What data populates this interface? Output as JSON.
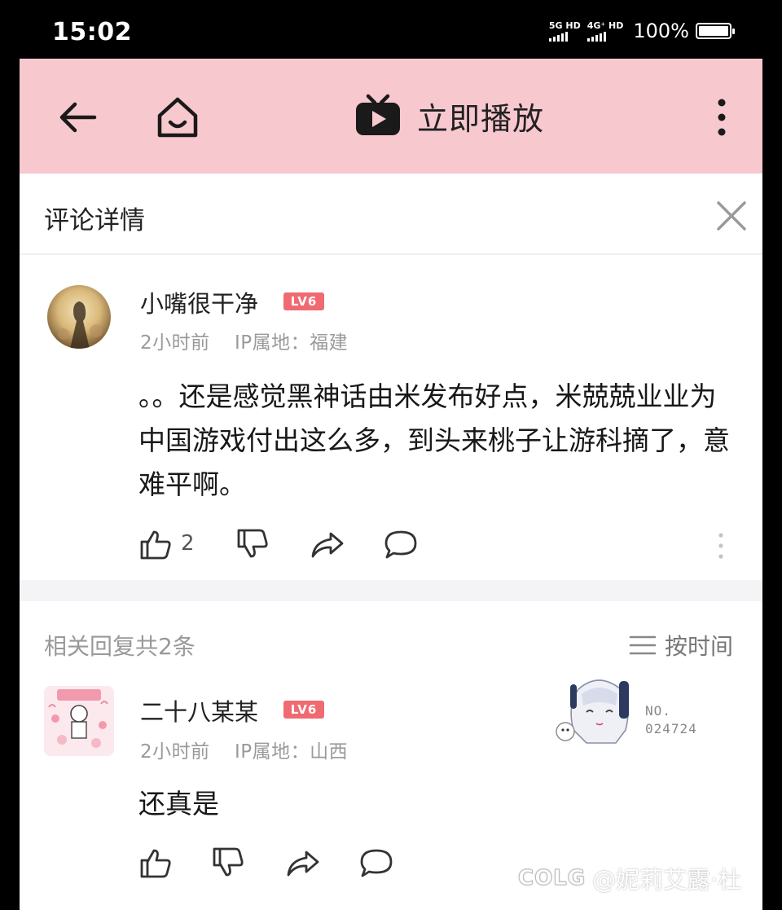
{
  "status_bar": {
    "time": "15:02",
    "network_1": "5G HD",
    "network_2": "4G⁺ HD",
    "battery_percent": "100%"
  },
  "top_bar": {
    "play_label": "立即播放",
    "icons": [
      "back-arrow-icon",
      "home-icon",
      "tv-play-icon",
      "more-vertical-icon"
    ]
  },
  "detail_header": {
    "title": "评论详情"
  },
  "main_comment": {
    "username": "小嘴很干净",
    "level_badge": "LV6",
    "time": "2小时前",
    "ip_location": "IP属地：福建",
    "content": "。。还是感觉黑神话由米发布好点，米兢兢业业为中国游戏付出这么多，到头来桃子让游科摘了，意难平啊。",
    "like_count": "2"
  },
  "replies": {
    "count_label": "相关回复共2条",
    "sort_label": "按时间"
  },
  "reply_comment": {
    "username": "二十八某某",
    "level_badge": "LV6",
    "time": "2小时前",
    "ip_location": "IP属地：山西",
    "content": "还真是",
    "pendant_no_label": "NO.",
    "pendant_no_value": "024724"
  },
  "watermark": {
    "logo": "COLG",
    "text": "@妮莉艾露·杜"
  },
  "colors": {
    "header_bg": "#f8c8cf",
    "level_badge": "#f06a72",
    "meta_text": "#9a9a9a"
  }
}
